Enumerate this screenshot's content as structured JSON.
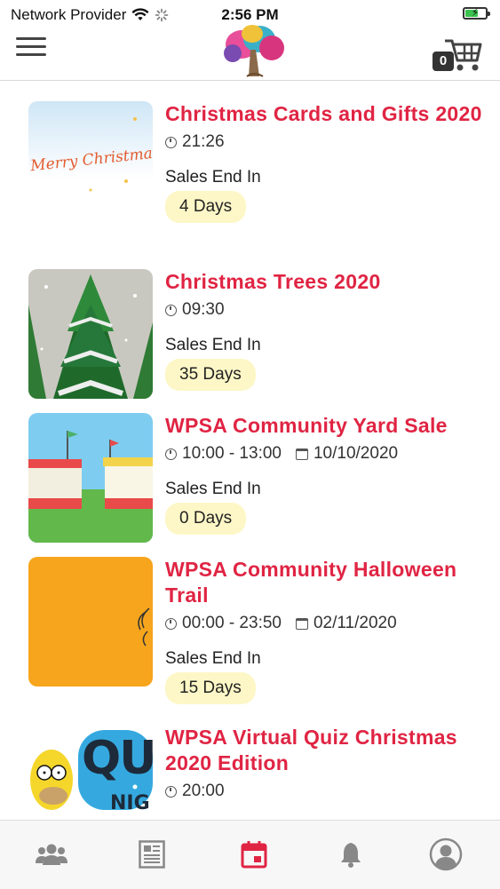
{
  "status_bar": {
    "carrier": "Network Provider",
    "time": "2:56 PM"
  },
  "header": {
    "cart_count": "0"
  },
  "events": [
    {
      "title": "Christmas Cards and Gifts 2020",
      "time": "21:26",
      "date": "",
      "sales_label": "Sales End In",
      "days": "4 Days",
      "thumb_text": "Merry Christmas"
    },
    {
      "title": "Christmas Trees 2020",
      "time": "09:30",
      "date": "",
      "sales_label": "Sales End In",
      "days": "35 Days"
    },
    {
      "title": "WPSA Community Yard Sale",
      "time": "10:00 - 13:00",
      "date": "10/10/2020",
      "sales_label": "Sales End In",
      "days": "0 Days"
    },
    {
      "title": "WPSA Community Halloween Trail",
      "time": "00:00 - 23:50",
      "date": "02/11/2020",
      "sales_label": "Sales End In",
      "days": "15 Days"
    },
    {
      "title": "WPSA Virtual Quiz Christmas 2020 Edition",
      "time": "20:00",
      "date": "",
      "thumb_text": [
        "QU",
        "NIG"
      ]
    }
  ],
  "tabbar": {
    "items": [
      {
        "icon": "people-icon",
        "active": false
      },
      {
        "icon": "news-icon",
        "active": false
      },
      {
        "icon": "calendar-icon",
        "active": true
      },
      {
        "icon": "bell-icon",
        "active": false
      },
      {
        "icon": "profile-icon",
        "active": false
      }
    ]
  },
  "colors": {
    "accent": "#e02443",
    "pill": "#fdf7c7",
    "tab_inactive": "#888888"
  }
}
